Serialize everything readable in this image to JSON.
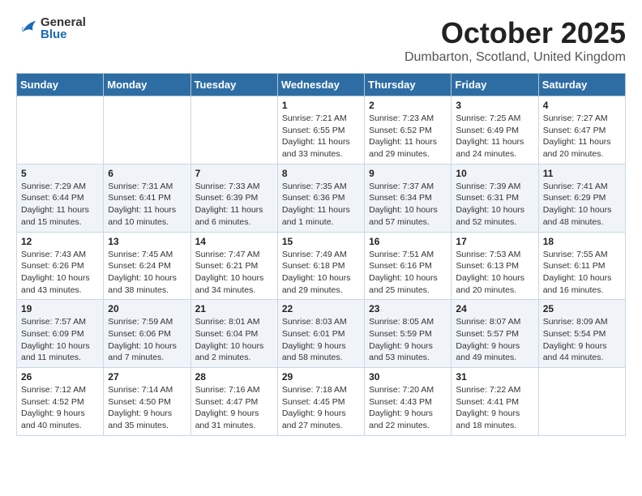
{
  "header": {
    "logo_general": "General",
    "logo_blue": "Blue",
    "month_year": "October 2025",
    "location": "Dumbarton, Scotland, United Kingdom"
  },
  "days_of_week": [
    "Sunday",
    "Monday",
    "Tuesday",
    "Wednesday",
    "Thursday",
    "Friday",
    "Saturday"
  ],
  "weeks": [
    [
      {
        "day": "",
        "info": ""
      },
      {
        "day": "",
        "info": ""
      },
      {
        "day": "",
        "info": ""
      },
      {
        "day": "1",
        "info": "Sunrise: 7:21 AM\nSunset: 6:55 PM\nDaylight: 11 hours\nand 33 minutes."
      },
      {
        "day": "2",
        "info": "Sunrise: 7:23 AM\nSunset: 6:52 PM\nDaylight: 11 hours\nand 29 minutes."
      },
      {
        "day": "3",
        "info": "Sunrise: 7:25 AM\nSunset: 6:49 PM\nDaylight: 11 hours\nand 24 minutes."
      },
      {
        "day": "4",
        "info": "Sunrise: 7:27 AM\nSunset: 6:47 PM\nDaylight: 11 hours\nand 20 minutes."
      }
    ],
    [
      {
        "day": "5",
        "info": "Sunrise: 7:29 AM\nSunset: 6:44 PM\nDaylight: 11 hours\nand 15 minutes."
      },
      {
        "day": "6",
        "info": "Sunrise: 7:31 AM\nSunset: 6:41 PM\nDaylight: 11 hours\nand 10 minutes."
      },
      {
        "day": "7",
        "info": "Sunrise: 7:33 AM\nSunset: 6:39 PM\nDaylight: 11 hours\nand 6 minutes."
      },
      {
        "day": "8",
        "info": "Sunrise: 7:35 AM\nSunset: 6:36 PM\nDaylight: 11 hours\nand 1 minute."
      },
      {
        "day": "9",
        "info": "Sunrise: 7:37 AM\nSunset: 6:34 PM\nDaylight: 10 hours\nand 57 minutes."
      },
      {
        "day": "10",
        "info": "Sunrise: 7:39 AM\nSunset: 6:31 PM\nDaylight: 10 hours\nand 52 minutes."
      },
      {
        "day": "11",
        "info": "Sunrise: 7:41 AM\nSunset: 6:29 PM\nDaylight: 10 hours\nand 48 minutes."
      }
    ],
    [
      {
        "day": "12",
        "info": "Sunrise: 7:43 AM\nSunset: 6:26 PM\nDaylight: 10 hours\nand 43 minutes."
      },
      {
        "day": "13",
        "info": "Sunrise: 7:45 AM\nSunset: 6:24 PM\nDaylight: 10 hours\nand 38 minutes."
      },
      {
        "day": "14",
        "info": "Sunrise: 7:47 AM\nSunset: 6:21 PM\nDaylight: 10 hours\nand 34 minutes."
      },
      {
        "day": "15",
        "info": "Sunrise: 7:49 AM\nSunset: 6:18 PM\nDaylight: 10 hours\nand 29 minutes."
      },
      {
        "day": "16",
        "info": "Sunrise: 7:51 AM\nSunset: 6:16 PM\nDaylight: 10 hours\nand 25 minutes."
      },
      {
        "day": "17",
        "info": "Sunrise: 7:53 AM\nSunset: 6:13 PM\nDaylight: 10 hours\nand 20 minutes."
      },
      {
        "day": "18",
        "info": "Sunrise: 7:55 AM\nSunset: 6:11 PM\nDaylight: 10 hours\nand 16 minutes."
      }
    ],
    [
      {
        "day": "19",
        "info": "Sunrise: 7:57 AM\nSunset: 6:09 PM\nDaylight: 10 hours\nand 11 minutes."
      },
      {
        "day": "20",
        "info": "Sunrise: 7:59 AM\nSunset: 6:06 PM\nDaylight: 10 hours\nand 7 minutes."
      },
      {
        "day": "21",
        "info": "Sunrise: 8:01 AM\nSunset: 6:04 PM\nDaylight: 10 hours\nand 2 minutes."
      },
      {
        "day": "22",
        "info": "Sunrise: 8:03 AM\nSunset: 6:01 PM\nDaylight: 9 hours\nand 58 minutes."
      },
      {
        "day": "23",
        "info": "Sunrise: 8:05 AM\nSunset: 5:59 PM\nDaylight: 9 hours\nand 53 minutes."
      },
      {
        "day": "24",
        "info": "Sunrise: 8:07 AM\nSunset: 5:57 PM\nDaylight: 9 hours\nand 49 minutes."
      },
      {
        "day": "25",
        "info": "Sunrise: 8:09 AM\nSunset: 5:54 PM\nDaylight: 9 hours\nand 44 minutes."
      }
    ],
    [
      {
        "day": "26",
        "info": "Sunrise: 7:12 AM\nSunset: 4:52 PM\nDaylight: 9 hours\nand 40 minutes."
      },
      {
        "day": "27",
        "info": "Sunrise: 7:14 AM\nSunset: 4:50 PM\nDaylight: 9 hours\nand 35 minutes."
      },
      {
        "day": "28",
        "info": "Sunrise: 7:16 AM\nSunset: 4:47 PM\nDaylight: 9 hours\nand 31 minutes."
      },
      {
        "day": "29",
        "info": "Sunrise: 7:18 AM\nSunset: 4:45 PM\nDaylight: 9 hours\nand 27 minutes."
      },
      {
        "day": "30",
        "info": "Sunrise: 7:20 AM\nSunset: 4:43 PM\nDaylight: 9 hours\nand 22 minutes."
      },
      {
        "day": "31",
        "info": "Sunrise: 7:22 AM\nSunset: 4:41 PM\nDaylight: 9 hours\nand 18 minutes."
      },
      {
        "day": "",
        "info": ""
      }
    ]
  ]
}
